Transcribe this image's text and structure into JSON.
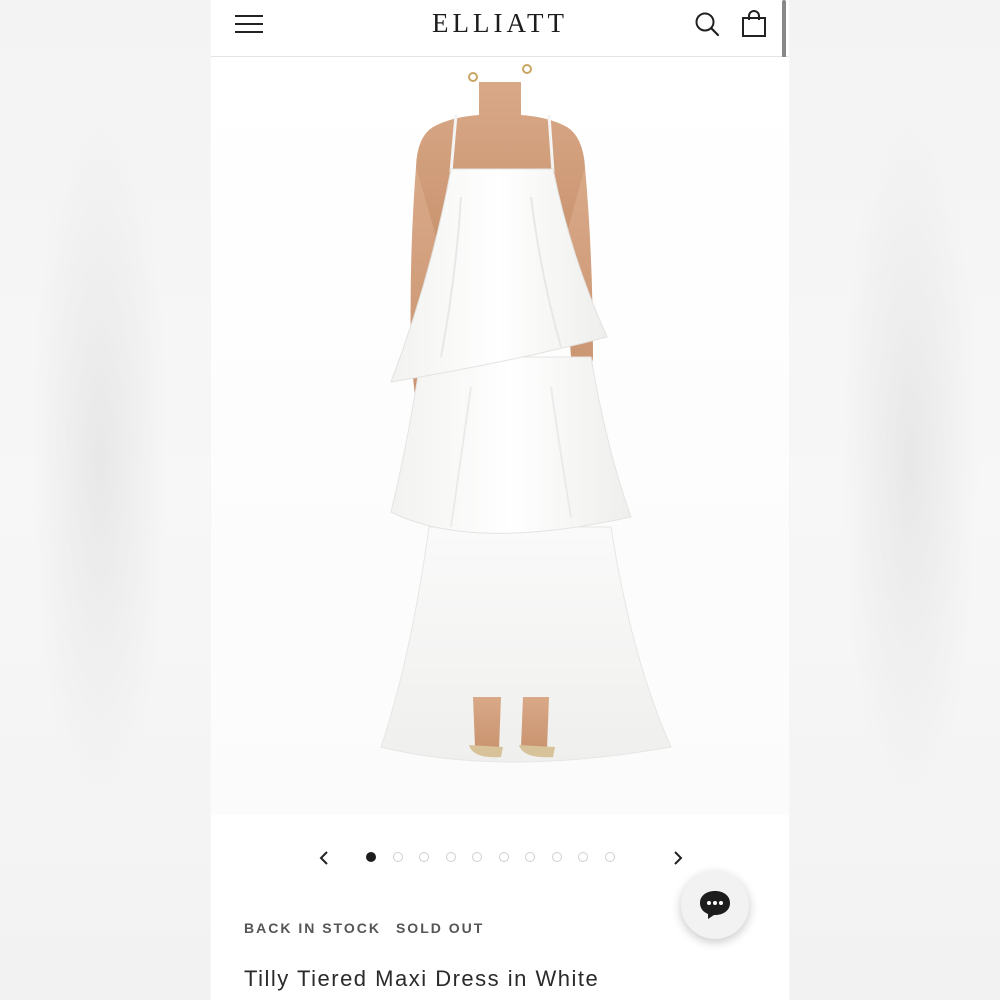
{
  "header": {
    "brand": "ELLIATT",
    "menu_icon": "hamburger-menu-icon",
    "search_icon": "search-icon",
    "bag_icon": "shopping-bag-icon"
  },
  "gallery": {
    "image_alt": "Model wearing white tiered maxi dress",
    "total_images": 10,
    "active_index": 0,
    "prev_icon": "chevron-left-icon",
    "next_icon": "chevron-right-icon"
  },
  "product": {
    "badges": [
      "BACK IN STOCK",
      "SOLD OUT"
    ],
    "title": "Tilly Tiered Maxi Dress in White"
  },
  "chat": {
    "icon": "chat-bubble-icon"
  },
  "colors": {
    "text_dark": "#1d1d1d",
    "badge_text": "#555555",
    "dot_active": "#1d1d1d",
    "dot_inactive": "#cfcfcf"
  }
}
